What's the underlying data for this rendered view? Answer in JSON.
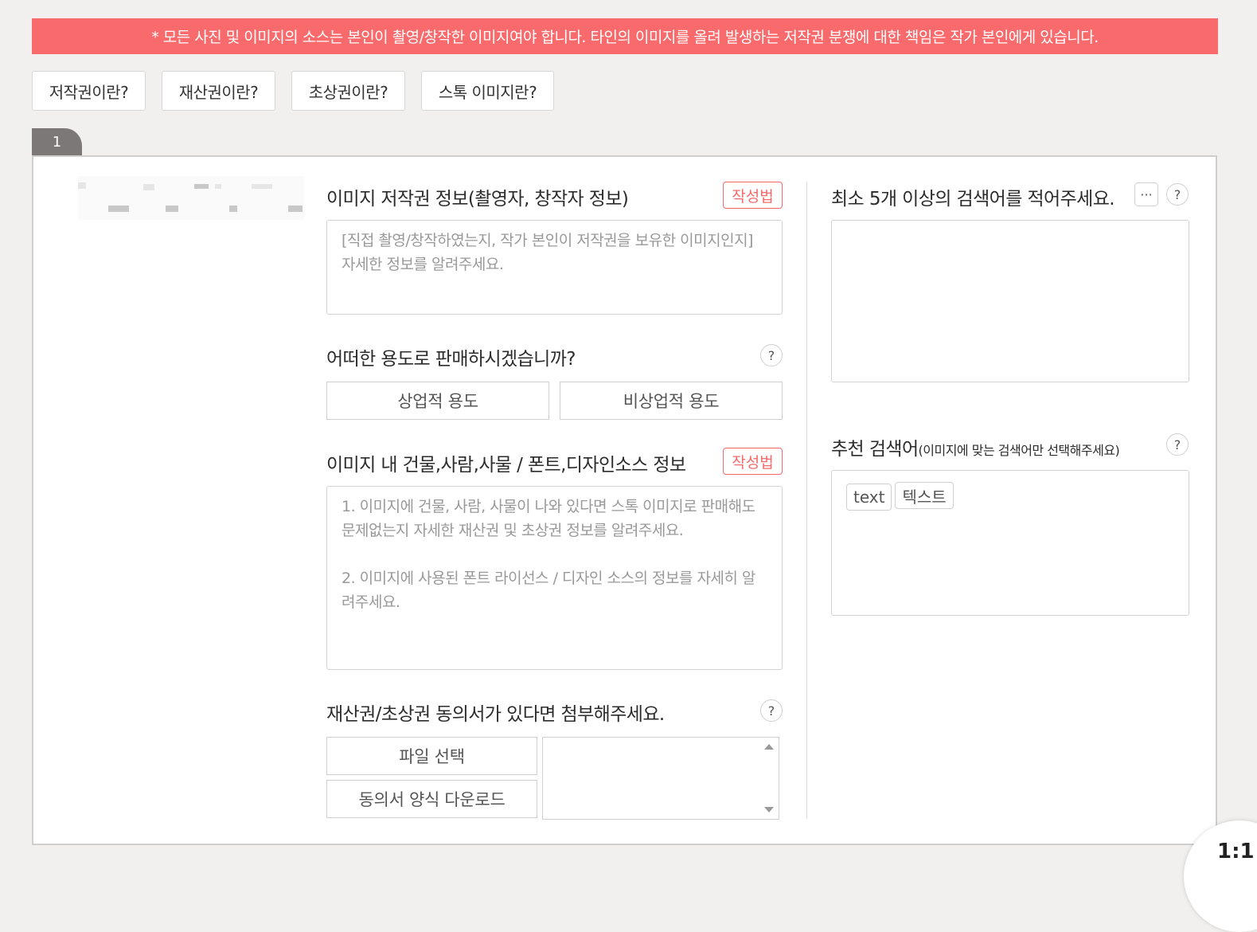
{
  "notice": "* 모든 사진 및 이미지의 소스는 본인이 촬영/창작한 이미지여야 합니다. 타인의 이미지를 올려 발생하는 저작권 분쟁에 대한 책임은 작가 본인에게 있습니다.",
  "info_buttons": [
    "저작권이란?",
    "재산권이란?",
    "초상권이란?",
    "스톡 이미지란?"
  ],
  "tab_label": "1",
  "copyright": {
    "label": "이미지 저작권 정보(촬영자, 창작자 정보)",
    "guide": "작성법",
    "placeholder": "[직접 촬영/창작하였는지, 작가 본인이 저작권을 보유한 이미지인지] 자세한 정보를 알려주세요."
  },
  "usage": {
    "label": "어떠한 용도로 판매하시겠습니까?",
    "help": "?",
    "options": [
      "상업적 용도",
      "비상업적 용도"
    ]
  },
  "source_info": {
    "label": "이미지 내 건물,사람,사물 / 폰트,디자인소스 정보",
    "guide": "작성법",
    "placeholder": "1. 이미지에 건물, 사람, 사물이 나와 있다면 스톡 이미지로 판매해도 문제없는지 자세한 재산권 및 초상권 정보를 알려주세요.\n\n2. 이미지에 사용된 폰트 라이선스 / 디자인 소스의 정보를 자세히 알려주세요."
  },
  "consent": {
    "label": "재산권/초상권 동의서가 있다면 첨부해주세요.",
    "help": "?",
    "file_button": "파일 선택",
    "download_button": "동의서 양식 다운로드"
  },
  "keywords": {
    "label": "최소 5개 이상의 검색어를 적어주세요.",
    "more": "···",
    "help": "?"
  },
  "recommended": {
    "label": "추천 검색어",
    "label_note": "(이미지에 맞는 검색어만 선택해주세요)",
    "help": "?",
    "tags": [
      "text",
      "텍스트"
    ]
  },
  "zoom_label": "1:1"
}
